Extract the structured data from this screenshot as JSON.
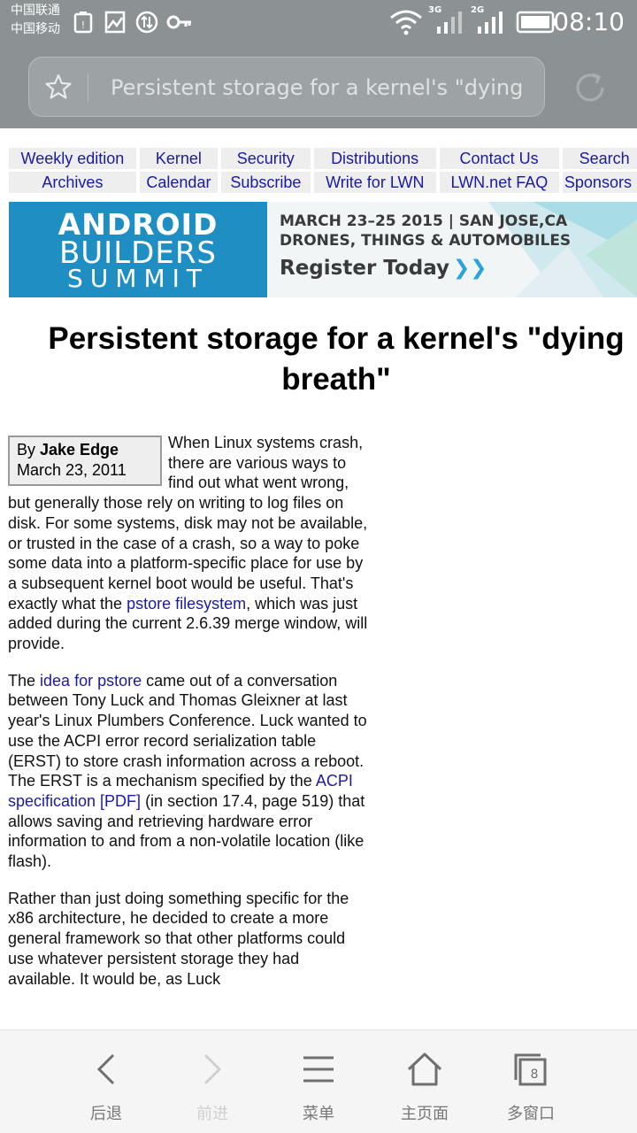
{
  "status_bar": {
    "carrier1": "中国联通",
    "carrier2": "中国移动",
    "net1": "3G",
    "net2": "2G",
    "time": "08:10"
  },
  "address_bar": {
    "url_text": "Persistent storage for a kernel's \"dying breath\""
  },
  "nav": {
    "row1": [
      "Weekly edition",
      "Kernel",
      "Security",
      "Distributions",
      "Contact Us",
      "Search"
    ],
    "row2": [
      "Archives",
      "Calendar",
      "Subscribe",
      "Write for LWN",
      "LWN.net FAQ",
      "Sponsors"
    ]
  },
  "banner": {
    "logo_line1": "ANDROID",
    "logo_line2": "BUILDERS",
    "logo_line3": "SUMMIT",
    "line1": "MARCH 23–25 2015 | SAN JOSE,CA",
    "line2": "DRONES, THINGS & AUTOMOBILES",
    "cta": "Register Today",
    "cta_arrows": "❯❯"
  },
  "article": {
    "title": "Persistent storage for a kernel's \"dying breath\"",
    "by": "By ",
    "author": "Jake Edge",
    "date": "March 23, 2011",
    "p1_a": "When Linux systems crash, there are various ways to find out what went wrong, but generally those rely on writing to log files on disk. For some systems, disk may not be available, or trusted in the case of a crash, so a way to poke some data into a platform-specific place for use by a subsequent kernel boot would be useful. That's exactly what the ",
    "p1_link": "pstore filesystem",
    "p1_b": ", which was just added during the current 2.6.39 merge window, will provide.",
    "p2_a": "The ",
    "p2_link1": "idea for pstore",
    "p2_b": " came out of a conversation between Tony Luck and Thomas Gleixner at last year's Linux Plumbers Conference. Luck wanted to use the ACPI error record serialization table (ERST) to store crash information across a reboot. The ERST is a mechanism specified by the ",
    "p2_link2": "ACPI specification [PDF]",
    "p2_c": " (in section 17.4, page 519) that allows saving and retrieving hardware error information to and from a non-volatile location (like flash).",
    "p3": "Rather than just doing something specific for the x86 architecture, he decided to create a more general framework so that other platforms could use whatever persistent storage they had available. It would be, as Luck"
  },
  "toolbar": {
    "back": "后退",
    "forward": "前进",
    "menu": "菜单",
    "home": "主页面",
    "windows": "多窗口",
    "window_count": "8"
  }
}
